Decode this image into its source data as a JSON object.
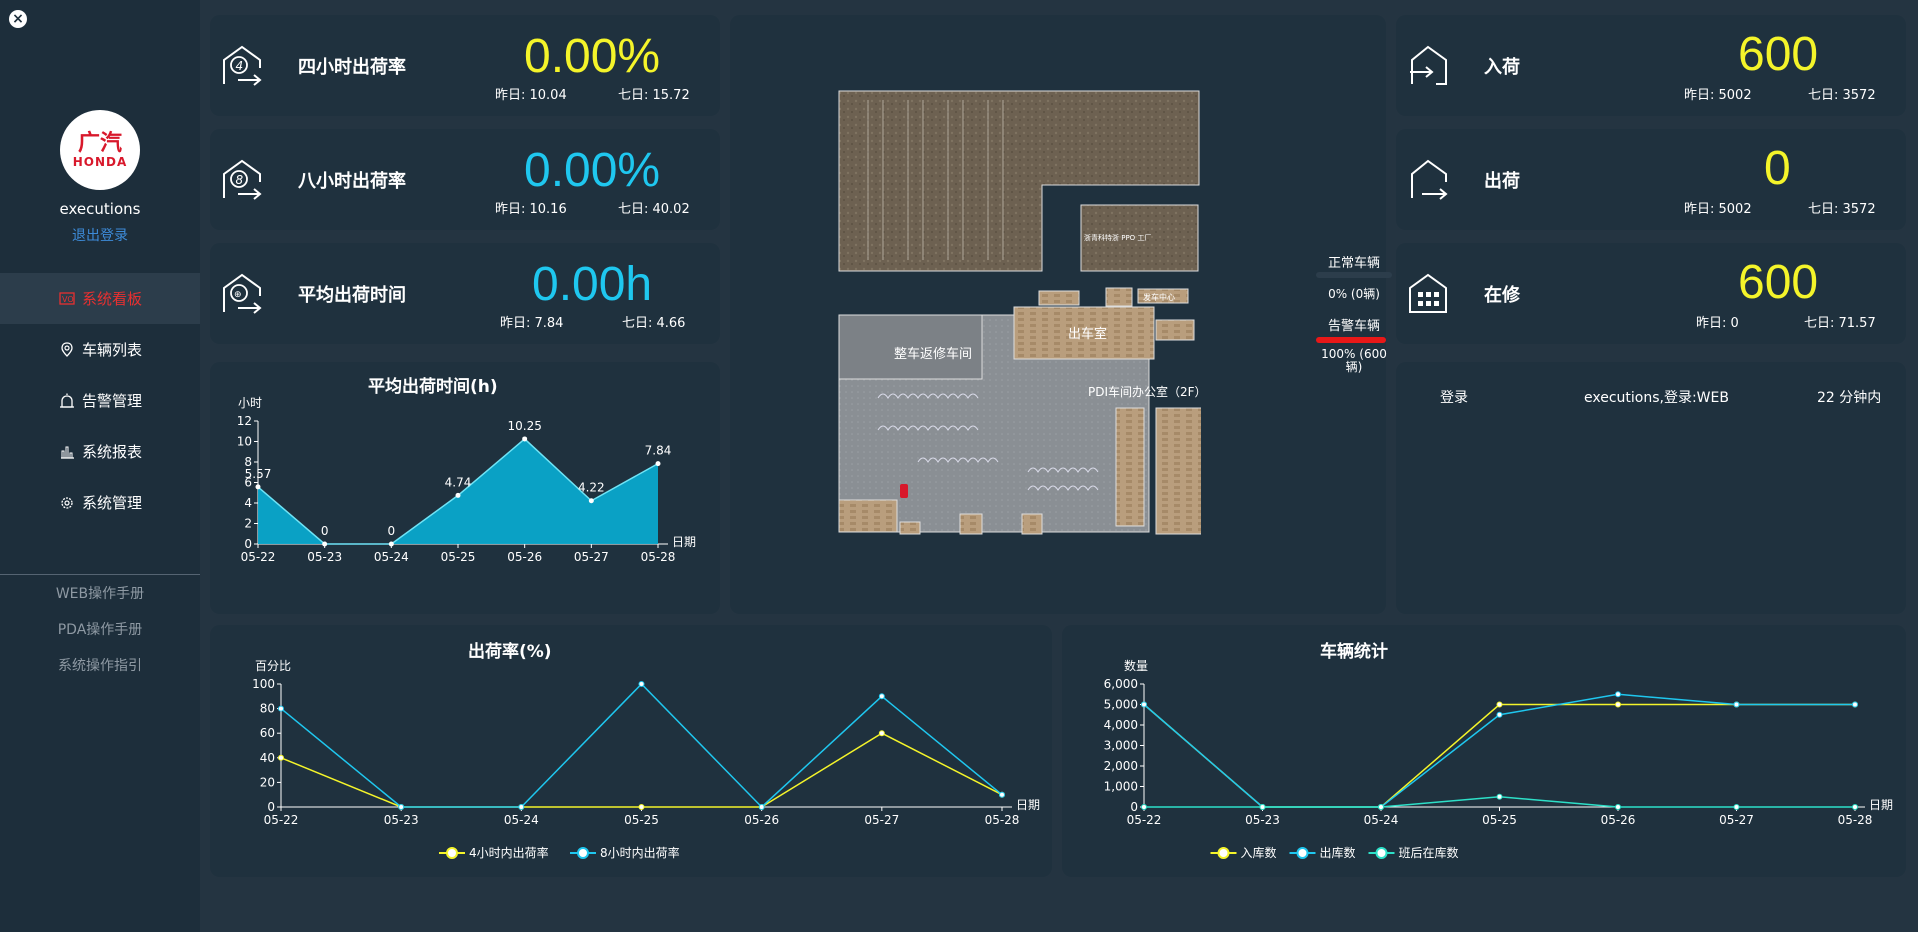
{
  "sidebar": {
    "close_label": "×",
    "logo_top": "广汽",
    "logo_bottom": "HONDA",
    "username": "executions",
    "logout": "退出登录",
    "nav": [
      {
        "label": "系统看板",
        "icon": "dashboard-icon",
        "active": true
      },
      {
        "label": "车辆列表",
        "icon": "map-pin-icon",
        "active": false
      },
      {
        "label": "告警管理",
        "icon": "alarm-icon",
        "active": false
      },
      {
        "label": "系统报表",
        "icon": "bar-chart-icon",
        "active": false
      },
      {
        "label": "系统管理",
        "icon": "gear-icon",
        "active": false
      }
    ],
    "manuals": [
      "WEB操作手册",
      "PDA操作手册",
      "系统操作指引"
    ]
  },
  "kpis_left": [
    {
      "label": "四小时出荷率",
      "value": "0.00%",
      "yesterday": "昨日: 10.04",
      "week": "七日: 15.72",
      "color": "#f4f42a",
      "badge": "4"
    },
    {
      "label": "八小时出荷率",
      "value": "0.00%",
      "yesterday": "昨日: 10.16",
      "week": "七日: 40.02",
      "color": "#1fc7ef",
      "badge": "8"
    },
    {
      "label": "平均出荷时间",
      "value": "0.00h",
      "yesterday": "昨日: 7.84",
      "week": "七日: 4.66",
      "color": "#1fc7ef",
      "badge": "⊕"
    }
  ],
  "kpis_right": [
    {
      "label": "入荷",
      "value": "600",
      "yesterday": "昨日: 5002",
      "week": "七日: 3572",
      "color": "#f4f42a"
    },
    {
      "label": "出荷",
      "value": "0",
      "yesterday": "昨日: 5002",
      "week": "七日: 3572",
      "color": "#f4f42a"
    },
    {
      "label": "在修",
      "value": "600",
      "yesterday": "昨日: 0",
      "week": "七日: 71.57",
      "color": "#f4f42a"
    }
  ],
  "map": {
    "labels": {
      "factory": "浙青科特浙 PPO 工厂",
      "repair": "整车返修车间",
      "shipping": "出车室",
      "dispatch": "发车中心",
      "office": "PDI车间办公室（2F）"
    },
    "legend": {
      "normal": "正常车辆",
      "normal_value": "0% (0辆)",
      "alarm": "告警车辆",
      "alarm_value": "100% (600辆)",
      "normal_color": "#1fc7ef",
      "alarm_color": "#e81818"
    }
  },
  "login": {
    "action": "登录",
    "detail": "executions,登录:WEB",
    "time": "22 分钟内"
  },
  "charts": {
    "avg_time": {
      "type": "area",
      "title": "平均出荷时间(h)",
      "ylabel": "小时",
      "xlabel": "日期",
      "categories": [
        "05-22",
        "05-23",
        "05-24",
        "05-25",
        "05-26",
        "05-27",
        "05-28"
      ],
      "values": [
        5.57,
        0,
        0,
        4.74,
        10.25,
        4.22,
        7.84
      ],
      "ylim": [
        0,
        12
      ],
      "yticks": [
        0,
        2,
        4,
        6,
        8,
        10,
        12
      ],
      "color": "#0aa8cc"
    },
    "ship_rate": {
      "type": "line",
      "title": "出荷率(%)",
      "ylabel": "百分比",
      "xlabel": "日期",
      "categories": [
        "05-22",
        "05-23",
        "05-24",
        "05-25",
        "05-26",
        "05-27",
        "05-28"
      ],
      "series": [
        {
          "name": "4小时内出荷率",
          "values": [
            40,
            0,
            0,
            0,
            0,
            60,
            10
          ],
          "color": "#f4f42a"
        },
        {
          "name": "8小时内出荷率",
          "values": [
            80,
            0,
            0,
            100,
            0,
            90,
            10
          ],
          "color": "#1fc7ef"
        }
      ],
      "ylim": [
        0,
        100
      ],
      "yticks": [
        0,
        20,
        40,
        60,
        80,
        100
      ]
    },
    "vehicle_stats": {
      "type": "line",
      "title": "车辆统计",
      "ylabel": "数量",
      "xlabel": "日期",
      "categories": [
        "05-22",
        "05-23",
        "05-24",
        "05-25",
        "05-26",
        "05-27",
        "05-28"
      ],
      "series": [
        {
          "name": "入库数",
          "values": [
            5000,
            0,
            0,
            5000,
            5000,
            5000,
            5000
          ],
          "color": "#f4f42a"
        },
        {
          "name": "出库数",
          "values": [
            5000,
            0,
            0,
            4500,
            5500,
            5000,
            5000
          ],
          "color": "#1fc7ef"
        },
        {
          "name": "班后在库数",
          "values": [
            0,
            0,
            0,
            500,
            0,
            0,
            0
          ],
          "color": "#2de0c8"
        }
      ],
      "ylim": [
        0,
        6000
      ],
      "yticks": [
        0,
        1000,
        2000,
        3000,
        4000,
        5000,
        6000
      ],
      "ytick_labels": [
        "0",
        "1,000",
        "2,000",
        "3,000",
        "4,000",
        "5,000",
        "6,000"
      ]
    }
  }
}
